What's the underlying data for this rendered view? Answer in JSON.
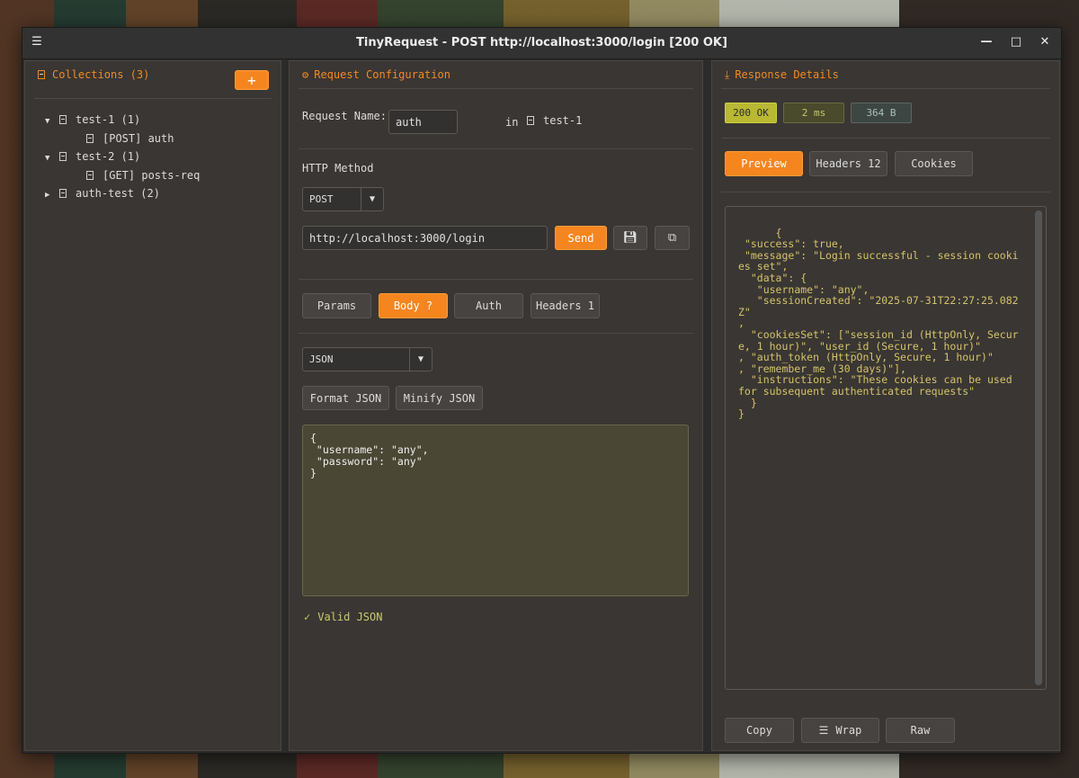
{
  "window": {
    "title": "TinyRequest - POST http://localhost:3000/login [200 OK]",
    "menu_icon": "☰",
    "minimize_icon": "—",
    "maximize_icon": "□",
    "close_icon": "✕"
  },
  "collections": {
    "header": "Collections (3)",
    "add_label": "+",
    "tree": [
      {
        "toggle": "▼",
        "label": "test-1 (1)"
      },
      {
        "label": "[POST] auth"
      },
      {
        "toggle": "▼",
        "label": "test-2 (1)"
      },
      {
        "label": "[GET] posts-req"
      },
      {
        "toggle": "▶",
        "label": "auth-test (2)"
      }
    ]
  },
  "request": {
    "header": "Request Configuration",
    "name_label": "Request Name:",
    "name_value": "auth",
    "in_label": "in",
    "collection": "test-1",
    "method_label": "HTTP Method",
    "method_value": "POST",
    "url_value": "http://localhost:3000/login",
    "send_label": "Send",
    "tabs": [
      "Params",
      "Body ?",
      "Auth",
      "Headers 1"
    ],
    "active_tab": "Body ?",
    "body_type": "JSON",
    "format_label": "Format JSON",
    "minify_label": "Minify JSON",
    "body": "{\n \"username\": \"any\",\n \"password\": \"any\"\n}",
    "valid_label": "Valid JSON"
  },
  "response": {
    "header": "Response Details",
    "status": "200 OK",
    "time": "2 ms",
    "size": "364 B",
    "tabs": [
      "Preview",
      "Headers 12",
      "Cookies"
    ],
    "active_tab": "Preview",
    "body": "{\n \"success\": true,\n \"message\": \"Login successful - session cookies set\",\n  \"data\": {\n   \"username\": \"any\",\n   \"sessionCreated\": \"2025-07-31T22:27:25.082Z\"\n,\n  \"cookiesSet\": [\"session_id (HttpOnly, Secure, 1 hour)\", \"user_id (Secure, 1 hour)\"\n, \"auth_token (HttpOnly, Secure, 1 hour)\"\n, \"remember_me (30 days)\"],\n  \"instructions\": \"These cookies can be used for subsequent authenticated requests\"\n  }\n}",
    "copy_label": "Copy",
    "wrap_label": "Wrap",
    "raw_label": "Raw"
  },
  "colors": {
    "accent": "#f5861f",
    "status_ok": "#b8b832",
    "editor_bg": "#4a4734"
  }
}
